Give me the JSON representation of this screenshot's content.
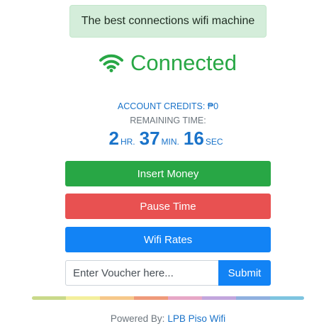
{
  "banner": {
    "text": "The best connections wifi machine",
    "bg_color": "#d4edda"
  },
  "status": {
    "icon": "wifi-icon",
    "text": "Connected",
    "color": "#28a745"
  },
  "account": {
    "credits_label": "ACCOUNT CREDITS: ₱0",
    "remaining_label": "REMAINING TIME:"
  },
  "timer": {
    "hours": "2",
    "hours_unit": "HR.",
    "minutes": "37",
    "minutes_unit": "MIN.",
    "seconds": "16",
    "seconds_unit": "SEC"
  },
  "buttons": {
    "insert_money": "Insert Money",
    "pause_time": "Pause Time",
    "wifi_rates": "Wifi Rates",
    "insert_money_color": "#28a745",
    "pause_time_color": "#e85151",
    "wifi_rates_color": "#1283f5"
  },
  "voucher": {
    "placeholder": "Enter Voucher here...",
    "value": "",
    "submit_label": "Submit"
  },
  "rainbow_colors": [
    "#c9d98a",
    "#f3ef9c",
    "#f6c88a",
    "#ef9a7a",
    "#e7a7c6",
    "#c2a6dd",
    "#8fb0df",
    "#7ec4e0"
  ],
  "footer": {
    "prefix": "Powered By:",
    "link_text": "LPB Piso Wifi"
  }
}
